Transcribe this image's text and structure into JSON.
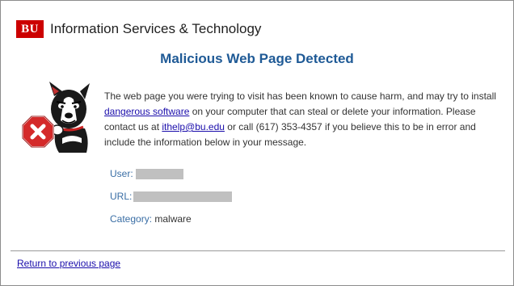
{
  "header": {
    "logo_text": "BU",
    "org_name": "Information Services & Technology"
  },
  "title": "Malicious Web Page Detected",
  "illustration": {
    "mascot_icon": "terrier-mascot-icon",
    "warning_icon": "red-x-stop-icon",
    "warning_color": "#d42a2a"
  },
  "message": {
    "part1": "The web page you were trying to visit has been known to cause harm, and may try to install ",
    "link1": "dangerous software",
    "part2": " on your computer that can steal or delete your information. Please contact us at ",
    "email_link": "ithelp@bu.edu",
    "part3": " or call (617) 353-4357 if you believe this to be in error and include the information below in your message."
  },
  "details": {
    "user_label": "User:",
    "user_value": "",
    "url_label": "URL:",
    "url_value": "",
    "category_label": "Category:",
    "category_value": "malware"
  },
  "footer": {
    "return_link": "Return to previous page"
  },
  "colors": {
    "title": "#1f5a96",
    "brand_red": "#cc0000",
    "link": "#1a0dab",
    "label": "#3a6ea5"
  }
}
